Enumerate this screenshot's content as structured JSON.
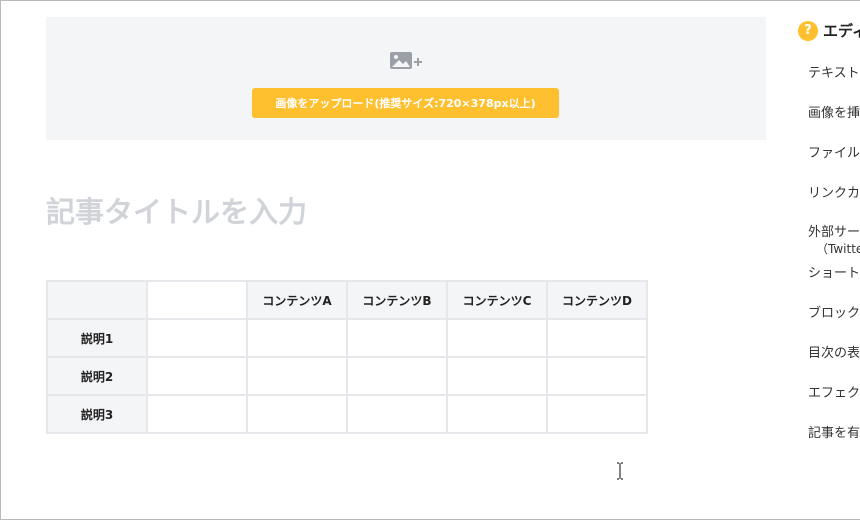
{
  "upload": {
    "icon": "image-add-icon",
    "button_label": "画像をアップロード(推奨サイズ:720×378px以上)"
  },
  "title_field": {
    "placeholder": "記事タイトルを入力",
    "value": ""
  },
  "table": {
    "headers": [
      "",
      "",
      "コンテンツA",
      "コンテンツB",
      "コンテンツC",
      "コンテンツD"
    ],
    "rows": [
      {
        "label": "説明1",
        "cells": [
          "",
          "",
          "",
          "",
          ""
        ]
      },
      {
        "label": "説明2",
        "cells": [
          "",
          "",
          "",
          "",
          ""
        ]
      },
      {
        "label": "説明3",
        "cells": [
          "",
          "",
          "",
          "",
          ""
        ]
      }
    ]
  },
  "help": {
    "icon": "question-icon",
    "icon_glyph": "?",
    "title": "エディ",
    "items": [
      {
        "label": "テキスト"
      },
      {
        "label": "画像を挿"
      },
      {
        "label": "ファイル"
      },
      {
        "label": "リンクカ"
      },
      {
        "label": "外部サー",
        "sub": "（Twitte"
      },
      {
        "label": "ショート"
      },
      {
        "label": "ブロック"
      },
      {
        "label": "目次の表"
      },
      {
        "label": "エフェク"
      },
      {
        "label": "記事を有"
      }
    ]
  },
  "colors": {
    "accent": "#ffc02f",
    "panel_bg": "#f4f5f7",
    "border": "#e6e7ea",
    "placeholder": "#d0d3d8"
  }
}
